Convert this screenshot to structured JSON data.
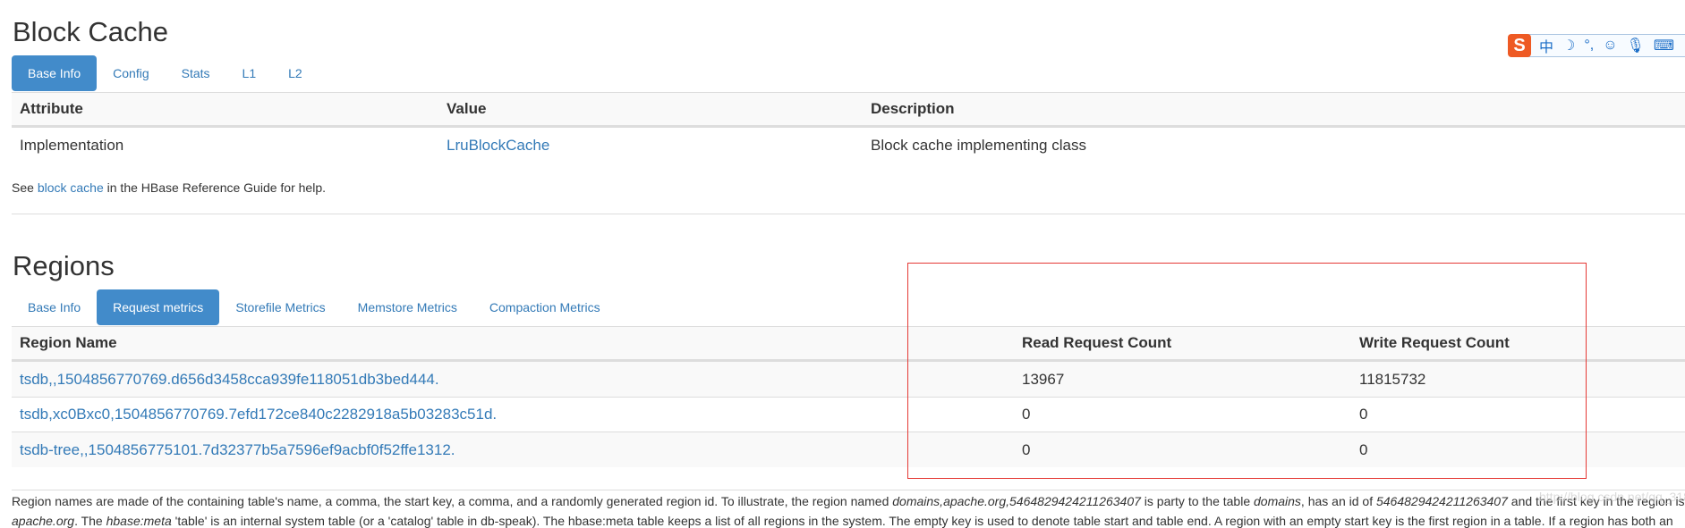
{
  "block_cache": {
    "title": "Block Cache",
    "tabs": [
      "Base Info",
      "Config",
      "Stats",
      "L1",
      "L2"
    ],
    "active_tab": "Base Info",
    "headers": [
      "Attribute",
      "Value",
      "Description"
    ],
    "rows": [
      [
        "Implementation",
        "LruBlockCache",
        "Block cache implementing class"
      ]
    ],
    "note_prefix": "See ",
    "note_link": "block cache",
    "note_suffix": " in the HBase Reference Guide for help."
  },
  "regions": {
    "title": "Regions",
    "tabs": [
      "Base Info",
      "Request metrics",
      "Storefile Metrics",
      "Memstore Metrics",
      "Compaction Metrics"
    ],
    "active_tab": "Request metrics",
    "headers": [
      "Region Name",
      "Read Request Count",
      "Write Request Count"
    ],
    "rows": [
      [
        "tsdb,,1504856770769.d656d3458cca939fe118051db3bed444.",
        "13967",
        "11815732"
      ],
      [
        "tsdb,xc0Bxc0,1504856770769.7efd172ce840c2282918a5b03283c51d.",
        "0",
        "0"
      ],
      [
        "tsdb-tree,,1504856775101.7d32377b5a7596ef9acbf0f52ffe1312.",
        "0",
        "0"
      ]
    ],
    "desc_line1": [
      "Region names are made of the containing table's name, a comma, the start key, a comma, and a randomly generated region id. To illustrate, the region named ",
      "domains,apache.org,5464829424211263407",
      " is party to the table ",
      "domains",
      ", has an id of ",
      "5464829424211263407",
      " and the first key in the region is"
    ],
    "desc_line2": [
      "apache.org",
      ". The ",
      "hbase:meta",
      " 'table' is an internal system table (or a 'catalog' table in db-speak). The hbase:meta table keeps a list of all regions in the system. The empty key is used to denote table start and table end. A region with an empty start key is the first region in a table. If a region has both an"
    ]
  },
  "ime_toolbar": {
    "logo": "S",
    "items": [
      "中",
      "☽",
      "°,",
      "☺",
      "🎙",
      "⌨",
      "👤"
    ]
  },
  "watermark": "http://blog.csdn.net/qq_31806205",
  "colors": {
    "accent": "#428bca",
    "link": "#337ab7",
    "highlight_box": "#e53935"
  }
}
